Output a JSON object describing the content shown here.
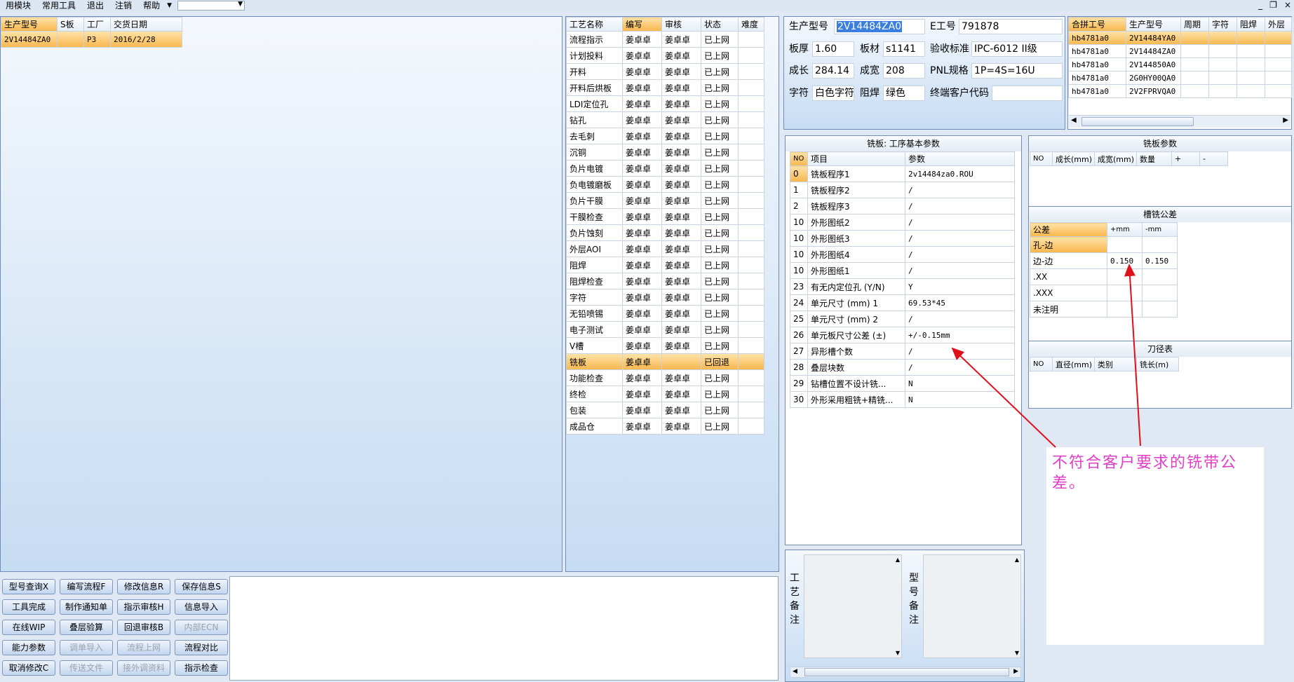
{
  "menu": {
    "items": [
      "用模块",
      "常用工具",
      "退出",
      "注销",
      "帮助"
    ],
    "window_controls": [
      "_",
      "❐",
      "×"
    ]
  },
  "orders": {
    "headers": [
      "生产型号",
      "S板",
      "工厂",
      "交货日期"
    ],
    "rows": [
      [
        "2V14484ZA0",
        "",
        "P3",
        "2016/2/28"
      ]
    ]
  },
  "process": {
    "headers": [
      "工艺名称",
      "编写",
      "审核",
      "状态",
      "难度"
    ],
    "rows": [
      [
        "流程指示",
        "姜卓卓",
        "姜卓卓",
        "已上网",
        ""
      ],
      [
        "计划投料",
        "姜卓卓",
        "姜卓卓",
        "已上网",
        ""
      ],
      [
        "开料",
        "姜卓卓",
        "姜卓卓",
        "已上网",
        ""
      ],
      [
        "开料后烘板",
        "姜卓卓",
        "姜卓卓",
        "已上网",
        ""
      ],
      [
        "LDI定位孔",
        "姜卓卓",
        "姜卓卓",
        "已上网",
        ""
      ],
      [
        "钻孔",
        "姜卓卓",
        "姜卓卓",
        "已上网",
        ""
      ],
      [
        "去毛刺",
        "姜卓卓",
        "姜卓卓",
        "已上网",
        ""
      ],
      [
        "沉铜",
        "姜卓卓",
        "姜卓卓",
        "已上网",
        ""
      ],
      [
        "负片电镀",
        "姜卓卓",
        "姜卓卓",
        "已上网",
        ""
      ],
      [
        "负电镀磨板",
        "姜卓卓",
        "姜卓卓",
        "已上网",
        ""
      ],
      [
        "负片干膜",
        "姜卓卓",
        "姜卓卓",
        "已上网",
        ""
      ],
      [
        "干膜检查",
        "姜卓卓",
        "姜卓卓",
        "已上网",
        ""
      ],
      [
        "负片蚀刻",
        "姜卓卓",
        "姜卓卓",
        "已上网",
        ""
      ],
      [
        "外层AOI",
        "姜卓卓",
        "姜卓卓",
        "已上网",
        ""
      ],
      [
        "阻焊",
        "姜卓卓",
        "姜卓卓",
        "已上网",
        ""
      ],
      [
        "阻焊检查",
        "姜卓卓",
        "姜卓卓",
        "已上网",
        ""
      ],
      [
        "字符",
        "姜卓卓",
        "姜卓卓",
        "已上网",
        ""
      ],
      [
        "无铅喷锡",
        "姜卓卓",
        "姜卓卓",
        "已上网",
        ""
      ],
      [
        "电子测试",
        "姜卓卓",
        "姜卓卓",
        "已上网",
        ""
      ],
      [
        "V槽",
        "姜卓卓",
        "姜卓卓",
        "已上网",
        ""
      ],
      [
        "铣板",
        "姜卓卓",
        "",
        "已回退",
        ""
      ],
      [
        "功能检查",
        "姜卓卓",
        "姜卓卓",
        "已上网",
        ""
      ],
      [
        "终检",
        "姜卓卓",
        "姜卓卓",
        "已上网",
        ""
      ],
      [
        "包装",
        "姜卓卓",
        "姜卓卓",
        "已上网",
        ""
      ],
      [
        "成品仓",
        "姜卓卓",
        "姜卓卓",
        "已上网",
        ""
      ]
    ],
    "selected_index": 20
  },
  "info": {
    "model_label": "生产型号",
    "model_value": "2V14484ZA0",
    "e_label": "E工号",
    "e_value": "791878",
    "thick_label": "板厚",
    "thick_value": "1.60",
    "mat_label": "板材",
    "mat_value": "s1141",
    "std_label": "验收标准",
    "std_value": "IPC-6012 II级",
    "len_label": "成长",
    "len_value": "284.14",
    "wid_label": "成宽",
    "wid_value": "208",
    "pnl_label": "PNL规格",
    "pnl_value": "1P=4S=16U",
    "char_label": "字符",
    "char_value": "白色字符",
    "mask_label": "阻焊",
    "mask_value": "绿色",
    "cust_label": "终端客户代码",
    "cust_value": ""
  },
  "merged": {
    "headers": [
      "合拼工号",
      "生产型号",
      "周期",
      "字符",
      "阻焊",
      "外层"
    ],
    "rows": [
      [
        "hb4781a0",
        "2V14484YA0",
        "",
        "",
        "",
        ""
      ],
      [
        "hb4781a0",
        "2V14484ZA0",
        "",
        "",
        "",
        ""
      ],
      [
        "hb4781a0",
        "2V144850A0",
        "",
        "",
        "",
        ""
      ],
      [
        "hb4781a0",
        "2G0HY00QA0",
        "",
        "",
        "",
        ""
      ],
      [
        "hb4781a0",
        "2V2FPRVQA0",
        "",
        "",
        "",
        ""
      ]
    ]
  },
  "params": {
    "title": "铣板: 工序基本参数",
    "headers": [
      "NO",
      "项目",
      "参数"
    ],
    "rows": [
      [
        "0",
        "铣板程序1",
        "2v14484za0.ROU"
      ],
      [
        "1",
        "铣板程序2",
        "/"
      ],
      [
        "2",
        "铣板程序3",
        "/"
      ],
      [
        "10",
        "外形图纸2",
        "/"
      ],
      [
        "10",
        "外形图纸3",
        "/"
      ],
      [
        "10",
        "外形图纸4",
        "/"
      ],
      [
        "10",
        "外形图纸1",
        "/"
      ],
      [
        "23",
        "有无内定位孔 (Y/N)",
        "Y"
      ],
      [
        "24",
        "单元尺寸 (mm) 1",
        "69.53*45"
      ],
      [
        "25",
        "单元尺寸 (mm) 2",
        "/"
      ],
      [
        "26",
        "单元板尺寸公差 (±)",
        "+/-0.15mm"
      ],
      [
        "27",
        "异形槽个数",
        "/"
      ],
      [
        "28",
        "叠层块数",
        "/"
      ],
      [
        "29",
        "钻槽位置不设计铣...",
        "N"
      ],
      [
        "30",
        "外形采用粗铣+精铣...",
        "N"
      ]
    ]
  },
  "mill": {
    "title": "铣板参数",
    "headers": [
      "NO",
      "成长(mm)",
      "成宽(mm)",
      "数量",
      "+",
      "-"
    ]
  },
  "tol": {
    "title": "槽铣公差",
    "headers": [
      "公差",
      "+mm",
      "-mm"
    ],
    "rows": [
      [
        "孔-边",
        "",
        ""
      ],
      [
        "边-边",
        "0.150",
        "0.150"
      ],
      [
        ".XX",
        "",
        ""
      ],
      [
        ".XXX",
        "",
        ""
      ],
      [
        "未注明",
        "",
        ""
      ]
    ]
  },
  "tool": {
    "title": "刀径表",
    "headers": [
      "NO",
      "直径(mm)",
      "类别",
      "铣长(m)"
    ]
  },
  "remarks": {
    "proc_label": "工艺备注",
    "model_label": "型号备注"
  },
  "buttons": [
    [
      "型号查询X",
      "编写流程F",
      "修改信息R",
      "保存信息S"
    ],
    [
      "工具完成",
      "制作通知单",
      "指示审核H",
      "信息导入"
    ],
    [
      "在线WIP",
      "叠层验算",
      "回退审核B",
      "内部ECN"
    ],
    [
      "能力参数",
      "调单导入",
      "流程上网",
      "流程对比"
    ],
    [
      "取消修改C",
      "传送文件",
      "接外调资料",
      "指示检查"
    ]
  ],
  "disabled_buttons": [
    "内部ECN",
    "调单导入",
    "流程上网",
    "传送文件",
    "接外调资料"
  ],
  "annotation": {
    "text": "不符合客户要求的铣带公差。",
    "color": "#e040c8",
    "arrow_color": "#e0101a"
  }
}
